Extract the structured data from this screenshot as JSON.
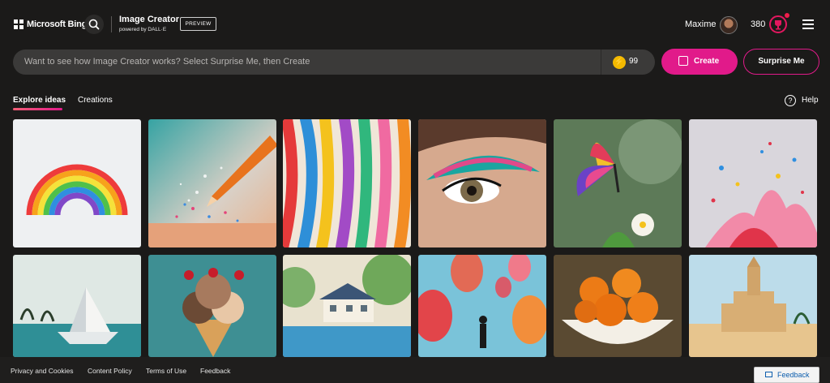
{
  "header": {
    "brand": "Microsoft Bing",
    "app_title": "Image Creator",
    "app_subtitle": "powered by DALL·E",
    "badge": "PREVIEW",
    "user_name": "Maxime",
    "reward_points": "380",
    "icons": {
      "search": "search-icon",
      "menu": "hamburger-menu-icon",
      "rewards": "rewards-icon"
    }
  },
  "prompt": {
    "placeholder": "Want to see how Image Creator works? Select Surprise Me, then Create",
    "boost_count": "99",
    "create_label": "Create",
    "surprise_label": "Surprise Me"
  },
  "tabs": [
    {
      "label": "Explore ideas",
      "active": true
    },
    {
      "label": "Creations",
      "active": false
    }
  ],
  "help_label": "Help",
  "gallery": [
    "rainbow",
    "colored pencil",
    "ribbons",
    "eye makeup",
    "butterfly",
    "paint splash",
    "paper boat",
    "ice cream",
    "lake house",
    "hot air balloons",
    "oranges",
    "sand castle"
  ],
  "footer": {
    "links": [
      "Privacy and Cookies",
      "Content Policy",
      "Terms of Use",
      "Feedback"
    ],
    "feedback_button": "Feedback"
  },
  "colors": {
    "accent": "#e11a8a",
    "background": "#1b1a19",
    "prompt_bg": "#3b3a39",
    "boost": "#f3b900"
  }
}
